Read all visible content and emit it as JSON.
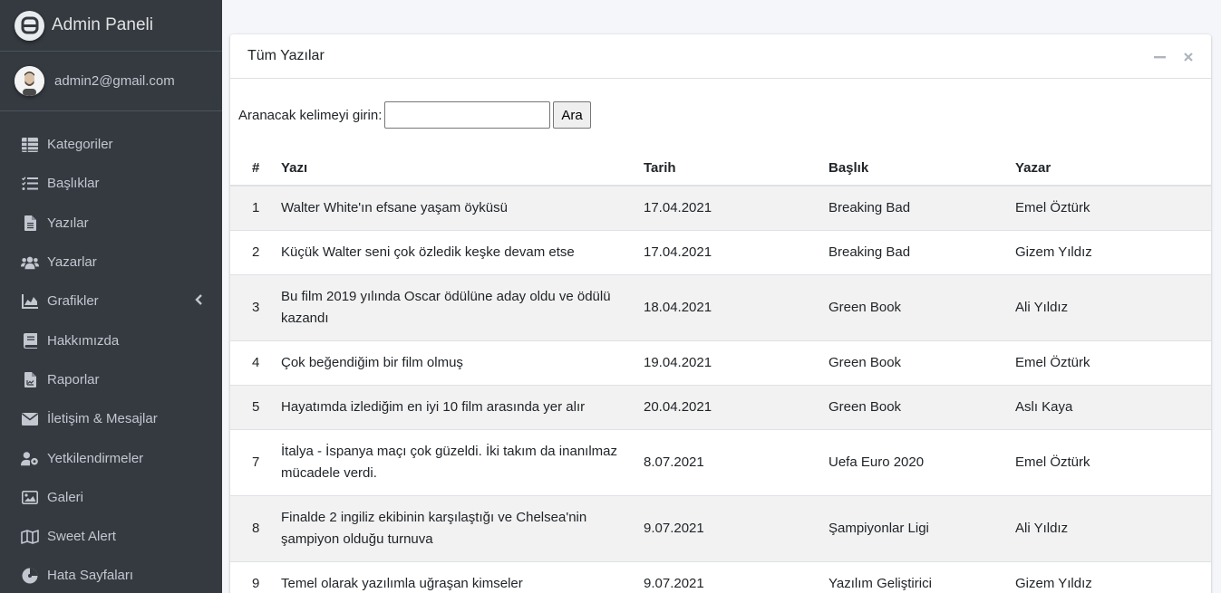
{
  "sidebar": {
    "brand": "Admin Paneli",
    "user": "admin2@gmail.com",
    "items": [
      {
        "label": "Kategoriler",
        "icon": "table-icon"
      },
      {
        "label": "Başlıklar",
        "icon": "list-icon"
      },
      {
        "label": "Yazılar",
        "icon": "file-icon"
      },
      {
        "label": "Yazarlar",
        "icon": "users-icon"
      },
      {
        "label": "Grafikler",
        "icon": "chart-icon"
      },
      {
        "label": "Hakkımızda",
        "icon": "book-icon"
      },
      {
        "label": "Raporlar",
        "icon": "report-icon"
      },
      {
        "label": "İletişim & Mesajlar",
        "icon": "envelope-icon"
      },
      {
        "label": "Yetkilendirmeler",
        "icon": "user-cog-icon"
      },
      {
        "label": "Galeri",
        "icon": "image-icon"
      },
      {
        "label": "Sweet Alert",
        "icon": "map-icon"
      },
      {
        "label": "Hata Sayfaları",
        "icon": "alert-icon"
      }
    ]
  },
  "card": {
    "title": "Tüm Yazılar",
    "search_label": "Aranacak kelimeyi girin:",
    "search_value": "",
    "search_button": "Ara"
  },
  "table": {
    "headers": [
      "#",
      "Yazı",
      "Tarih",
      "Başlık",
      "Yazar"
    ],
    "rows": [
      [
        "1",
        "Walter White'ın efsane yaşam öyküsü",
        "17.04.2021",
        "Breaking Bad",
        "Emel Öztürk"
      ],
      [
        "2",
        "Küçük Walter seni çok özledik keşke devam etse",
        "17.04.2021",
        "Breaking Bad",
        "Gizem Yıldız"
      ],
      [
        "3",
        "Bu film 2019 yılında Oscar ödülüne aday oldu ve ödülü kazandı",
        "18.04.2021",
        "Green Book",
        "Ali Yıldız"
      ],
      [
        "4",
        "Çok beğendiğim bir film olmuş",
        "19.04.2021",
        "Green Book",
        "Emel Öztürk"
      ],
      [
        "5",
        "Hayatımda izlediğim en iyi 10 film arasında yer alır",
        "20.04.2021",
        "Green Book",
        "Aslı Kaya"
      ],
      [
        "7",
        "İtalya - İspanya maçı çok güzeldi. İki takım da inanılmaz mücadele verdi.",
        "8.07.2021",
        "Uefa Euro 2020",
        "Emel Öztürk"
      ],
      [
        "8",
        "Finalde 2 ingiliz ekibinin karşılaştığı ve Chelsea'nin şampiyon olduğu turnuva",
        "9.07.2021",
        "Şampiyonlar Ligi",
        "Ali Yıldız"
      ],
      [
        "9",
        "Temel olarak yazılımla uğraşan kimseler",
        "9.07.2021",
        "Yazılım Geliştirici",
        "Gizem Yıldız"
      ]
    ]
  }
}
